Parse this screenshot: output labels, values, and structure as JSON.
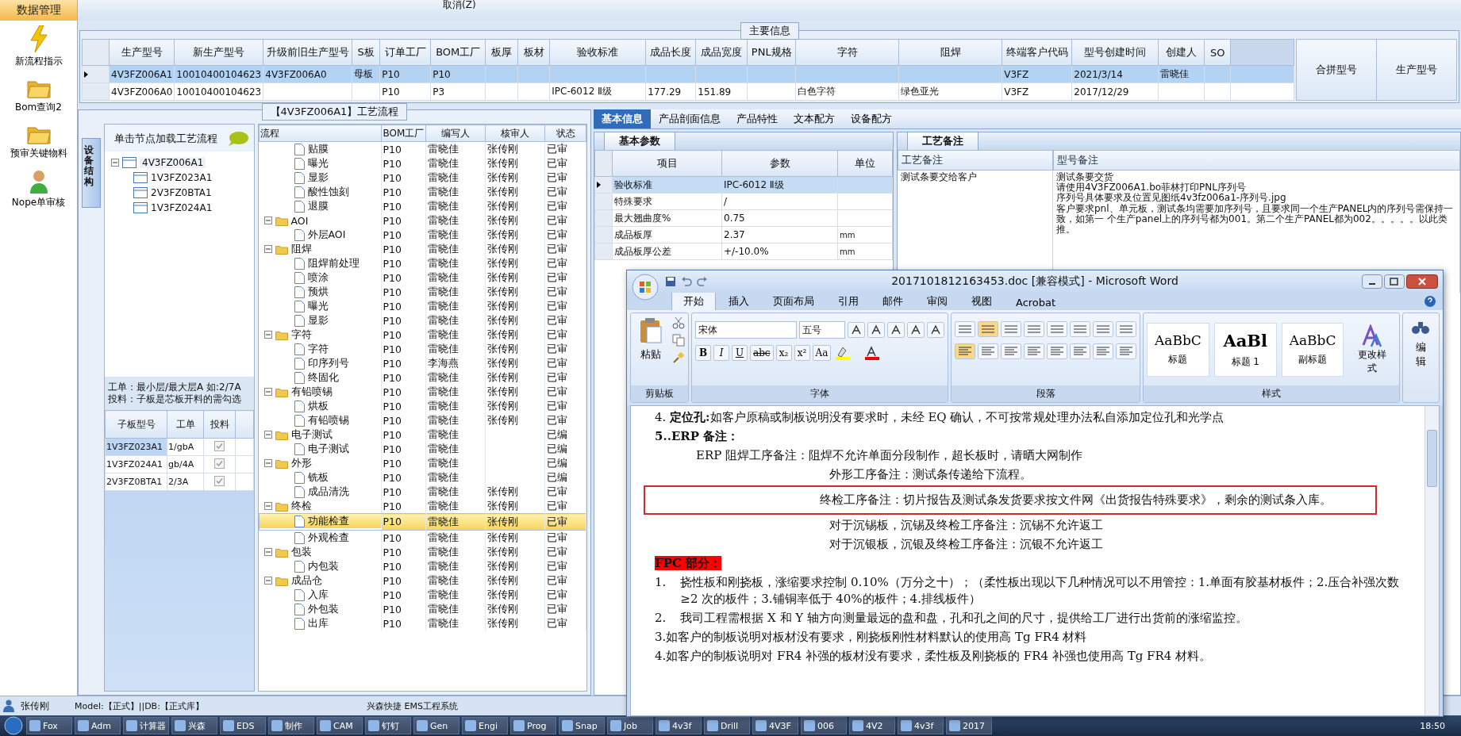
{
  "nav": {
    "title": "数据管理",
    "items": [
      {
        "label": "新流程指示",
        "kind": "lightning"
      },
      {
        "label": "Bom查询2",
        "kind": "folder"
      },
      {
        "label": "预审关键物料",
        "kind": "folder"
      },
      {
        "label": "Nope单审核",
        "kind": "person"
      }
    ]
  },
  "toolbar": {
    "cancel": "取消(Z)"
  },
  "main_info": {
    "title": "主要信息",
    "columns": [
      "生产型号",
      "新生产型号",
      "升级前旧生产型号",
      "S板",
      "订单工厂",
      "BOM工厂",
      "板厚",
      "板材",
      "验收标准",
      "成品长度",
      "成品宽度",
      "PNL规格",
      "字符",
      "阻焊",
      "终端客户代码",
      "型号创建时间",
      "创建人",
      "SO"
    ],
    "rows": [
      {
        "selected": true,
        "cells": [
          "4V3FZ006A1",
          "10010400104623",
          "4V3FZ006A0",
          "母板",
          "P10",
          "P10",
          null,
          null,
          null,
          null,
          null,
          null,
          null,
          null,
          "V3FZ",
          "2021/3/14",
          "雷晓佳",
          null
        ]
      },
      {
        "selected": false,
        "cells": [
          "4V3FZ006A0",
          "10010400104623",
          null,
          null,
          "P10",
          "P3",
          null,
          null,
          "IPC-6012 Ⅱ级",
          "177.29",
          "151.89",
          null,
          "白色字符",
          "绿色亚光",
          "V3FZ",
          "2017/12/29",
          null,
          null
        ]
      }
    ],
    "side_columns": [
      "合拼型号",
      "生产型号"
    ]
  },
  "process": {
    "title": "【4V3FZ006A1】工艺流程",
    "side_tab": "设备结构",
    "hint": "单击节点加载工艺流程",
    "tree": [
      {
        "label": "4V3FZ006A1",
        "selected": true,
        "expanded": true,
        "children": [
          {
            "label": "1V3FZ023A1",
            "selected": false
          },
          {
            "label": "2V3FZ0BTA1",
            "selected": false
          },
          {
            "label": "1V3FZ024A1",
            "selected": false
          }
        ]
      }
    ],
    "notes": [
      "工单：最小层/最大层A 如:2/7A",
      "投料：子板是芯板开料的需勾选"
    ],
    "child_table": {
      "columns": [
        "子板型号",
        "工单",
        "投料"
      ],
      "rows": [
        {
          "cells": [
            "1V3FZ023A1",
            "1/gbA"
          ],
          "checked": true,
          "selected": true
        },
        {
          "cells": [
            "1V3FZ024A1",
            "gb/4A"
          ],
          "checked": true,
          "selected": false
        },
        {
          "cells": [
            "2V3FZ0BTA1",
            "2/3A"
          ],
          "checked": true,
          "selected": false
        }
      ]
    },
    "flow": {
      "columns": [
        "流程",
        "BOM工厂",
        "编写人",
        "核审人",
        "状态"
      ],
      "rows": [
        {
          "kind": "step",
          "name": "贴膜",
          "factory": "P10",
          "writer": "雷晓佳",
          "reviewer": "张传刚",
          "status": "已审",
          "selected": false
        },
        {
          "kind": "step",
          "name": "曝光",
          "factory": "P10",
          "writer": "雷晓佳",
          "reviewer": "张传刚",
          "status": "已审",
          "selected": false
        },
        {
          "kind": "step",
          "name": "显影",
          "factory": "P10",
          "writer": "雷晓佳",
          "reviewer": "张传刚",
          "status": "已审",
          "selected": false
        },
        {
          "kind": "step",
          "name": "酸性蚀刻",
          "factory": "P10",
          "writer": "雷晓佳",
          "reviewer": "张传刚",
          "status": "已审",
          "selected": false
        },
        {
          "kind": "step",
          "name": "退膜",
          "factory": "P10",
          "writer": "雷晓佳",
          "reviewer": "张传刚",
          "status": "已审",
          "selected": false
        },
        {
          "kind": "group",
          "name": "AOI",
          "factory": "P10",
          "writer": "雷晓佳",
          "reviewer": "张传刚",
          "status": "已审",
          "selected": false,
          "expanded": true,
          "children": [
            {
              "kind": "step",
              "name": "外层AOI",
              "factory": "P10",
              "writer": "雷晓佳",
              "reviewer": "张传刚",
              "status": "已审",
              "selected": false
            }
          ]
        },
        {
          "kind": "group",
          "name": "阻焊",
          "factory": "P10",
          "writer": "雷晓佳",
          "reviewer": "张传刚",
          "status": "已审",
          "selected": false,
          "expanded": true,
          "children": [
            {
              "kind": "step",
              "name": "阻焊前处理",
              "factory": "P10",
              "writer": "雷晓佳",
              "reviewer": "张传刚",
              "status": "已审",
              "selected": false
            },
            {
              "kind": "step",
              "name": "喷涂",
              "factory": "P10",
              "writer": "雷晓佳",
              "reviewer": "张传刚",
              "status": "已审",
              "selected": false
            },
            {
              "kind": "step",
              "name": "预烘",
              "factory": "P10",
              "writer": "雷晓佳",
              "reviewer": "张传刚",
              "status": "已审",
              "selected": false
            },
            {
              "kind": "step",
              "name": "曝光",
              "factory": "P10",
              "writer": "雷晓佳",
              "reviewer": "张传刚",
              "status": "已审",
              "selected": false
            },
            {
              "kind": "step",
              "name": "显影",
              "factory": "P10",
              "writer": "雷晓佳",
              "reviewer": "张传刚",
              "status": "已审",
              "selected": false
            }
          ]
        },
        {
          "kind": "group",
          "name": "字符",
          "factory": "P10",
          "writer": "雷晓佳",
          "reviewer": "张传刚",
          "status": "已审",
          "selected": false,
          "expanded": true,
          "children": [
            {
              "kind": "step",
              "name": "字符",
              "factory": "P10",
              "writer": "雷晓佳",
              "reviewer": "张传刚",
              "status": "已审",
              "selected": false
            },
            {
              "kind": "step",
              "name": "印序列号",
              "factory": "P10",
              "writer": "李海燕",
              "reviewer": "张传刚",
              "status": "已审",
              "selected": false
            },
            {
              "kind": "step",
              "name": "终固化",
              "factory": "P10",
              "writer": "雷晓佳",
              "reviewer": "张传刚",
              "status": "已审",
              "selected": false
            }
          ]
        },
        {
          "kind": "group",
          "name": "有铅喷锡",
          "factory": "P10",
          "writer": "雷晓佳",
          "reviewer": "张传刚",
          "status": "已审",
          "selected": false,
          "expanded": true,
          "children": [
            {
              "kind": "step",
              "name": "烘板",
              "factory": "P10",
              "writer": "雷晓佳",
              "reviewer": "张传刚",
              "status": "已审",
              "selected": false
            },
            {
              "kind": "step",
              "name": "有铅喷锡",
              "factory": "P10",
              "writer": "雷晓佳",
              "reviewer": "张传刚",
              "status": "已审",
              "selected": false
            }
          ]
        },
        {
          "kind": "group",
          "name": "电子测试",
          "factory": "P10",
          "writer": "雷晓佳",
          "status": "已编",
          "selected": false,
          "expanded": true,
          "children": [
            {
              "kind": "step",
              "name": "电子测试",
              "factory": "P10",
              "writer": "雷晓佳",
              "status": "已编",
              "selected": false
            }
          ]
        },
        {
          "kind": "group",
          "name": "外形",
          "factory": "P10",
          "writer": "雷晓佳",
          "status": "已编",
          "selected": false,
          "expanded": true,
          "children": [
            {
              "kind": "step",
              "name": "铣板",
              "factory": "P10",
              "writer": "雷晓佳",
              "status": "已编",
              "selected": false
            },
            {
              "kind": "step",
              "name": "成品清洗",
              "factory": "P10",
              "writer": "雷晓佳",
              "reviewer": "张传刚",
              "status": "已审",
              "selected": false
            }
          ]
        },
        {
          "kind": "group",
          "name": "终检",
          "factory": "P10",
          "writer": "雷晓佳",
          "reviewer": "张传刚",
          "status": "已审",
          "selected": false,
          "expanded": true,
          "children": [
            {
              "kind": "step",
              "name": "功能检查",
              "factory": "P10",
              "writer": "雷晓佳",
              "reviewer": "张传刚",
              "status": "已审",
              "selected": true
            },
            {
              "kind": "step",
              "name": "外观检查",
              "factory": "P10",
              "writer": "雷晓佳",
              "reviewer": "张传刚",
              "status": "已审",
              "selected": false
            }
          ]
        },
        {
          "kind": "group",
          "name": "包装",
          "factory": "P10",
          "writer": "雷晓佳",
          "reviewer": "张传刚",
          "status": "已审",
          "selected": false,
          "expanded": true,
          "children": [
            {
              "kind": "step",
              "name": "内包装",
              "factory": "P10",
              "writer": "雷晓佳",
              "reviewer": "张传刚",
              "status": "已审",
              "selected": false
            }
          ]
        },
        {
          "kind": "group",
          "name": "成品仓",
          "factory": "P10",
          "writer": "雷晓佳",
          "reviewer": "张传刚",
          "status": "已审",
          "selected": false,
          "expanded": true,
          "children": [
            {
              "kind": "step",
              "name": "入库",
              "factory": "P10",
              "writer": "雷晓佳",
              "reviewer": "张传刚",
              "status": "已审",
              "selected": false
            },
            {
              "kind": "step",
              "name": "外包装",
              "factory": "P10",
              "writer": "雷晓佳",
              "reviewer": "张传刚",
              "status": "已审",
              "selected": false
            },
            {
              "kind": "step",
              "name": "出库",
              "factory": "P10",
              "writer": "雷晓佳",
              "reviewer": "张传刚",
              "status": "已审",
              "selected": false
            }
          ]
        }
      ]
    }
  },
  "detail": {
    "tabs": [
      {
        "label": "基本信息",
        "selected": true
      },
      {
        "label": "产品剖面信息",
        "selected": false
      },
      {
        "label": "产品特性",
        "selected": false
      },
      {
        "label": "文本配方",
        "selected": false
      },
      {
        "label": "设备配方",
        "selected": false
      }
    ],
    "params": {
      "title": "基本参数",
      "columns": [
        "项目",
        "参数",
        "单位"
      ],
      "rows": [
        {
          "selected": true,
          "cells": [
            "验收标准",
            "IPC-6012 Ⅱ级",
            null
          ]
        },
        {
          "selected": false,
          "cells": [
            "特殊要求",
            "/",
            null
          ]
        },
        {
          "selected": false,
          "cells": [
            "最大翘曲度%",
            "0.75",
            null
          ]
        },
        {
          "selected": false,
          "cells": [
            "成品板厚",
            "2.37",
            "mm"
          ]
        },
        {
          "selected": false,
          "cells": [
            "成品板厚公差",
            "+/-10.0%",
            "mm"
          ]
        }
      ]
    },
    "remarks": {
      "title": "工艺备注",
      "columns": [
        "工艺备注",
        "型号备注"
      ],
      "process_note": "测试条要交给客户",
      "model_note": [
        "测试条要交货",
        "请使用4V3FZ006A1.bo菲林打印PNL序列号",
        "序列号具体要求及位置见图纸4v3fz006a1-序列号.jpg",
        "客户要求pnl、单元板，测试条均需要加序列号，且要求同一个生产PANEL内的序列号需保持一致，如第一 个生产panel上的序列号都为001。第二个生产PANEL都为002。。。。。以此类推。"
      ]
    }
  },
  "word": {
    "title": "2017101812163453.doc [兼容模式] - Microsoft Word",
    "tabs": [
      {
        "label": "开始",
        "selected": true
      },
      {
        "label": "插入",
        "selected": false
      },
      {
        "label": "页面布局",
        "selected": false
      },
      {
        "label": "引用",
        "selected": false
      },
      {
        "label": "邮件",
        "selected": false
      },
      {
        "label": "审阅",
        "selected": false
      },
      {
        "label": "视图",
        "selected": false
      },
      {
        "label": "Acrobat",
        "selected": false
      }
    ],
    "clipboard": {
      "paste": "粘贴",
      "group": "剪贴板"
    },
    "font": {
      "name": "宋体",
      "size": "五号",
      "group": "字体",
      "buttons": [
        "B",
        "I",
        "U",
        "abc",
        "x₂",
        "x²",
        "Aa"
      ]
    },
    "paragraph": {
      "group": "段落"
    },
    "styles": {
      "group": "样式",
      "items": [
        {
          "preview": "AaBbC",
          "name": "标题"
        },
        {
          "preview": "AaBl",
          "name": "标题 1"
        },
        {
          "preview": "AaBbC",
          "name": "副标题"
        }
      ],
      "change": "更改样式"
    },
    "editing": {
      "label": "编辑"
    },
    "paragraphs": [
      {
        "kind": "body",
        "text": "4.  **定位孔:**如客户原稿或制板说明没有要求时，未经 EQ 确认，不可按常规处理办法私自添加定位孔和光学点"
      },
      {
        "kind": "heading",
        "text": "5..ERP 备注："
      },
      {
        "kind": "indent",
        "text": "ERP 阻焊工序备注：阻焊不允许单面分段制作，超长板时，请晒大网制作"
      },
      {
        "kind": "indent2",
        "text": "外形工序备注：测试条传递给下流程。"
      },
      {
        "kind": "boxed",
        "text": "终检工序备注：切片报告及测试条发货要求按文件网《出货报告特殊要求》，剩余的测试条入库。"
      },
      {
        "kind": "indent2",
        "text": "对于沉锡板，沉锡及终检工序备注：沉锡不允许返工"
      },
      {
        "kind": "indent2",
        "text": "对于沉银板，沉银及终检工序备注：沉银不允许返工"
      },
      {
        "kind": "highlight",
        "text": "FPC 部分："
      },
      {
        "kind": "list",
        "num": "1.",
        "text": "挠性板和刚挠板，涨缩要求控制 0.10%（万分之十）；（柔性板出现以下几种情况可以不用管控：1.单面有胶基材板件；2.压合补强次数≥2 次的板件；3.铺铜率低于 40%的板件；4.排线板件）"
      },
      {
        "kind": "list",
        "num": "2.",
        "text": "我司工程需根据 X 和 Y 轴方向测量最远的盘和盘，孔和孔之间的尺寸，提供给工厂进行出货前的涨缩监控。"
      },
      {
        "kind": "body",
        "text": "3.如客户的制板说明对板材没有要求，刚挠板刚性材料默认的使用高 Tg FR4 材料"
      },
      {
        "kind": "body",
        "text": "4.如客户的制板说明对 FR4 补强的板材没有要求，柔性板及刚挠板的 FR4 补强也使用高 Tg FR4 材料。"
      }
    ]
  },
  "status_bar": {
    "user": "张传刚",
    "db": "Model:【正式】||DB:【正式库】",
    "system": "兴森快捷 EMS工程系统"
  },
  "taskbar": {
    "items": [
      "Fox",
      "Adm",
      "计算器",
      "兴森",
      "EDS",
      "制作",
      "CAM",
      "钉钉",
      "Gen",
      "Engi",
      "Prog",
      "Snap",
      "Job",
      "4v3f",
      "Drill",
      "4V3F",
      "006",
      "4V2",
      "4v3f",
      "2017"
    ],
    "clock": "18:50"
  }
}
